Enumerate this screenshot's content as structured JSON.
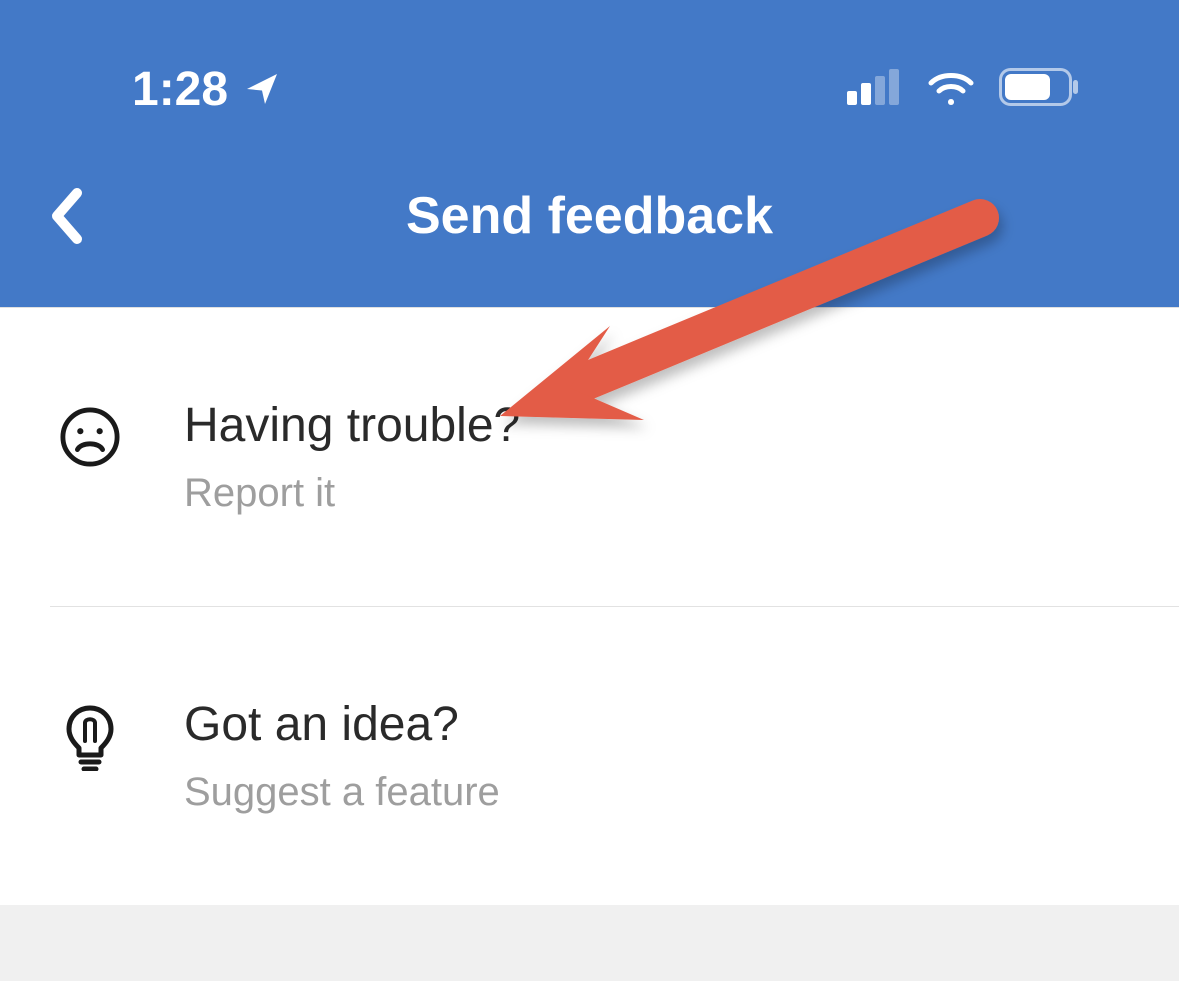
{
  "status_bar": {
    "time": "1:28"
  },
  "header": {
    "title": "Send feedback"
  },
  "items": [
    {
      "title": "Having trouble?",
      "subtitle": "Report it"
    },
    {
      "title": "Got an idea?",
      "subtitle": "Suggest a feature"
    }
  ]
}
